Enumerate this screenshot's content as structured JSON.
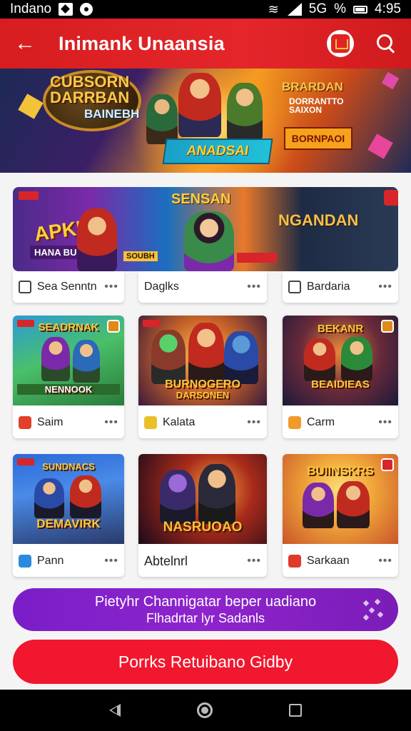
{
  "status_bar": {
    "carrier": "Indano",
    "network": "5G",
    "battery": "%",
    "time": "4:95"
  },
  "app_bar": {
    "title": "Inimank Unaansia",
    "back_icon": "arrow-left-icon",
    "brand_icon": "brand-logo-icon",
    "search_icon": "search-icon"
  },
  "hero": {
    "title_main": "CUBSORN DARRBAN",
    "title_sub": "BAINEBH",
    "ribbon": "ANADSAI",
    "right_title": "BRARDAN",
    "right_sub": "DORRANTTO SAIXON",
    "right_button": "BORNPAOI"
  },
  "wide_banner": {
    "left_text": "APKI",
    "left_sub": "HANA BUNIN",
    "left_tag": "SOUBH",
    "mid_title": "SENSAN",
    "right_title": "NGANDAN"
  },
  "cards_row1": [
    {
      "label": "Sea Senntn",
      "icon": "checkbox-icon"
    },
    {
      "label": "Daglks",
      "icon": "none"
    },
    {
      "label": "Bardaria",
      "icon": "checkbox-icon"
    }
  ],
  "cards_row2": [
    {
      "label": "Saim",
      "art_title": "SEADRNAK",
      "art_sub": "NENNOOK",
      "icon": "app-icon-red",
      "icon_color": "#e2402a"
    },
    {
      "label": "Kalata",
      "art_title": "BURNOGERO",
      "art_sub": "DARSONEN",
      "icon": "app-icon-yellow",
      "icon_color": "#e9c028"
    },
    {
      "label": "Carm",
      "art_title": "BEKANR",
      "art_sub": "BEAIDIEAS",
      "icon": "app-icon-orange",
      "icon_color": "#f09a2a"
    }
  ],
  "cards_row3": [
    {
      "label": "Pann",
      "art_title": "SUNDNACS",
      "art_sub": "DEMAVIRK",
      "icon": "app-icon-blue",
      "icon_color": "#2a8ae0"
    },
    {
      "label": "Abtelnrl",
      "art_title": "NASRUOAO",
      "icon": "none"
    },
    {
      "label": "Sarkaan",
      "art_title": "BUIINSKRS",
      "icon": "app-icon-red",
      "icon_color": "#e03a2a"
    }
  ],
  "more_label": "•••",
  "promo_banner": {
    "line1": "Pietyhr Channigatar beper uadiano",
    "line2": "Flhadrtar lyr Sadanls",
    "icon": "sparkle-icon"
  },
  "cta_button": {
    "label": "Porrks Retuibano Gidby"
  },
  "nav_bar": {
    "back": "nav-back-icon",
    "home": "nav-home-icon",
    "recent": "nav-recent-icon"
  },
  "colors": {
    "app_bar": "#e02426",
    "cta": "#f0172e",
    "promo": "#8a22c8"
  }
}
